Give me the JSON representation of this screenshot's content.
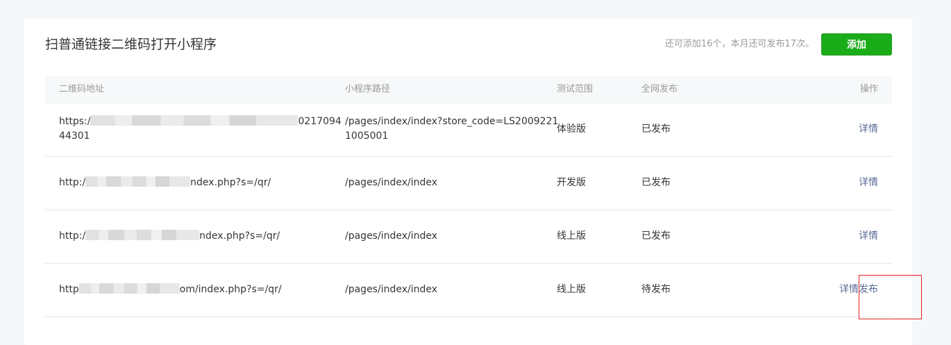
{
  "header": {
    "title": "扫普通链接二维码打开小程序",
    "quota_text": "还可添加16个，本月还可发布17次。",
    "add_button": "添加"
  },
  "table": {
    "columns": [
      "二维码地址",
      "小程序路径",
      "测试范围",
      "全网发布",
      "操作"
    ],
    "rows": [
      {
        "qr_prefix": "https:/",
        "qr_suffix": "0217094",
        "qr_line2": "44301",
        "path_line1": "/pages/index/index?store_code=LS2009221",
        "path_line2": "1005001",
        "scope": "体验版",
        "publish_status": "已发布",
        "action_detail": "详情"
      },
      {
        "qr_prefix": "http:/",
        "qr_suffix": "ndex.php?s=/qr/",
        "path": "/pages/index/index",
        "scope": "开发版",
        "publish_status": "已发布",
        "action_detail": "详情"
      },
      {
        "qr_prefix": "http:/",
        "qr_suffix": "ndex.php?s=/qr/",
        "path": "/pages/index/index",
        "scope": "线上版",
        "publish_status": "已发布",
        "action_detail": "详情"
      },
      {
        "qr_prefix": "http",
        "qr_suffix": "om/index.php?s=/qr/",
        "path": "/pages/index/index",
        "scope": "线上版",
        "publish_status": "待发布",
        "action_detail": "详情",
        "action_publish": "发布"
      }
    ]
  },
  "colors": {
    "primary_green": "#1aad19",
    "link_blue": "#576b95",
    "highlight_red": "#e02020"
  }
}
